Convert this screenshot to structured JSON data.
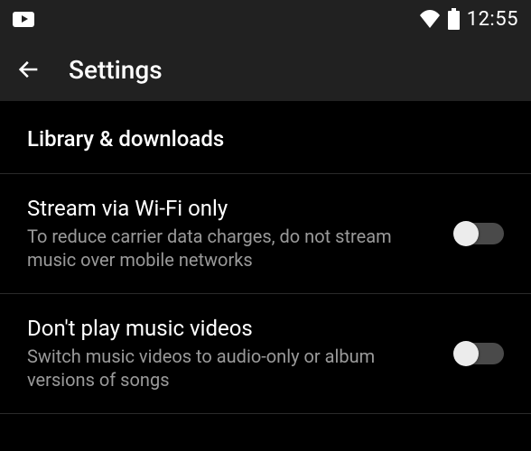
{
  "status": {
    "time": "12:55"
  },
  "header": {
    "title": "Settings"
  },
  "section": {
    "title": "Library & downloads"
  },
  "settings": [
    {
      "title": "Stream via Wi-Fi only",
      "description": "To reduce carrier data charges, do not stream music over mobile networks",
      "toggled": false
    },
    {
      "title": "Don't play music videos",
      "description": "Switch music videos to audio-only or album versions of songs",
      "toggled": false
    }
  ]
}
